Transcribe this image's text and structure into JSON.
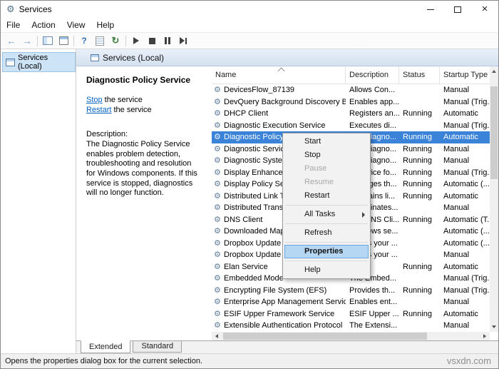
{
  "window": {
    "title": "Services"
  },
  "menu_bar": {
    "items": [
      "File",
      "Action",
      "View",
      "Help"
    ]
  },
  "toolbar": {
    "groups": [
      [
        "back",
        "forward"
      ],
      [
        "show-console-tree",
        "properties"
      ],
      [
        "help",
        "export-list",
        "refresh"
      ],
      [
        "start-service",
        "stop-service",
        "pause-service",
        "restart-service"
      ]
    ]
  },
  "tree_panel": {
    "root_label": "Services (Local)"
  },
  "result_header": {
    "title": "Services (Local)"
  },
  "detail_pane": {
    "service_title": "Diagnostic Policy Service",
    "actions": [
      {
        "link": "Stop",
        "rest": "the service"
      },
      {
        "link": "Restart",
        "rest": "the service"
      }
    ],
    "description_label": "Description:",
    "description_text": "The Diagnostic Policy Service enables problem detection, troubleshooting and resolution for Windows components.  If this service is stopped, diagnostics will no longer function."
  },
  "table": {
    "columns": [
      "Name",
      "Description",
      "Status",
      "Startup Type"
    ],
    "rows": [
      {
        "name": "DevicesFlow_87139",
        "description": "Allows Con...",
        "status": "",
        "startup": "Manual"
      },
      {
        "name": "DevQuery Background Discovery B...",
        "description": "Enables app...",
        "status": "",
        "startup": "Manual (Trig..."
      },
      {
        "name": "DHCP Client",
        "description": "Registers an...",
        "status": "Running",
        "startup": "Automatic"
      },
      {
        "name": "Diagnostic Execution Service",
        "description": "Executes di...",
        "status": "",
        "startup": "Manual (Trig..."
      },
      {
        "name": "Diagnostic Policy Service",
        "description": "The Diagno...",
        "status": "Running",
        "startup": "Automatic",
        "selected": true
      },
      {
        "name": "Diagnostic Service Host",
        "description": "The Diagno...",
        "status": "Running",
        "startup": "Manual"
      },
      {
        "name": "Diagnostic System Host",
        "description": "The Diagno...",
        "status": "Running",
        "startup": "Manual"
      },
      {
        "name": "Display Enhancement Service",
        "description": "A service fo...",
        "status": "Running",
        "startup": "Manual (Trig..."
      },
      {
        "name": "Display Policy Service",
        "description": "Manages th...",
        "status": "Running",
        "startup": "Automatic (..."
      },
      {
        "name": "Distributed Link Tracking Client",
        "description": "Maintains li...",
        "status": "Running",
        "startup": "Automatic"
      },
      {
        "name": "Distributed Transaction Coordinator",
        "description": "Coordinates...",
        "status": "",
        "startup": "Manual"
      },
      {
        "name": "DNS Client",
        "description": "The DNS Cli...",
        "status": "Running",
        "startup": "Automatic (T..."
      },
      {
        "name": "Downloaded Maps Manager",
        "description": "Windows se...",
        "status": "",
        "startup": "Automatic (..."
      },
      {
        "name": "Dropbox Update Service (dbupdate)",
        "description": "Keeps your ...",
        "status": "",
        "startup": "Automatic (..."
      },
      {
        "name": "Dropbox Update Service (dbupdatem)",
        "description": "Keeps your ...",
        "status": "",
        "startup": "Manual"
      },
      {
        "name": "Elan Service",
        "description": "",
        "status": "Running",
        "startup": "Automatic"
      },
      {
        "name": "Embedded Mode",
        "description": "The Embed...",
        "status": "",
        "startup": "Manual (Trig..."
      },
      {
        "name": "Encrypting File System (EFS)",
        "description": "Provides th...",
        "status": "Running",
        "startup": "Manual (Trig..."
      },
      {
        "name": "Enterprise App Management Service",
        "description": "Enables ent...",
        "status": "",
        "startup": "Manual"
      },
      {
        "name": "ESIF Upper Framework Service",
        "description": "ESIF Upper ...",
        "status": "Running",
        "startup": "Automatic"
      },
      {
        "name": "Extensible Authentication Protocol",
        "description": "The Extensi...",
        "status": "",
        "startup": "Manual"
      }
    ]
  },
  "context_menu": {
    "items": [
      {
        "label": "Start",
        "type": "item",
        "enabled": true
      },
      {
        "label": "Stop",
        "type": "item",
        "enabled": true
      },
      {
        "label": "Pause",
        "type": "item",
        "enabled": false
      },
      {
        "label": "Resume",
        "type": "item",
        "enabled": false
      },
      {
        "label": "Restart",
        "type": "item",
        "enabled": true
      },
      {
        "type": "separator"
      },
      {
        "label": "All Tasks",
        "type": "item",
        "enabled": true,
        "submenu": true
      },
      {
        "type": "separator"
      },
      {
        "label": "Refresh",
        "type": "item",
        "enabled": true
      },
      {
        "type": "separator"
      },
      {
        "label": "Properties",
        "type": "item",
        "enabled": true,
        "highlighted": true
      },
      {
        "type": "separator"
      },
      {
        "label": "Help",
        "type": "item",
        "enabled": true
      }
    ]
  },
  "view_tabs": [
    {
      "label": "Extended",
      "active": true
    },
    {
      "label": "Standard",
      "active": false
    }
  ],
  "status_bar": {
    "text": "Opens the properties dialog box for the current selection."
  },
  "watermark": "vsxdn.com"
}
